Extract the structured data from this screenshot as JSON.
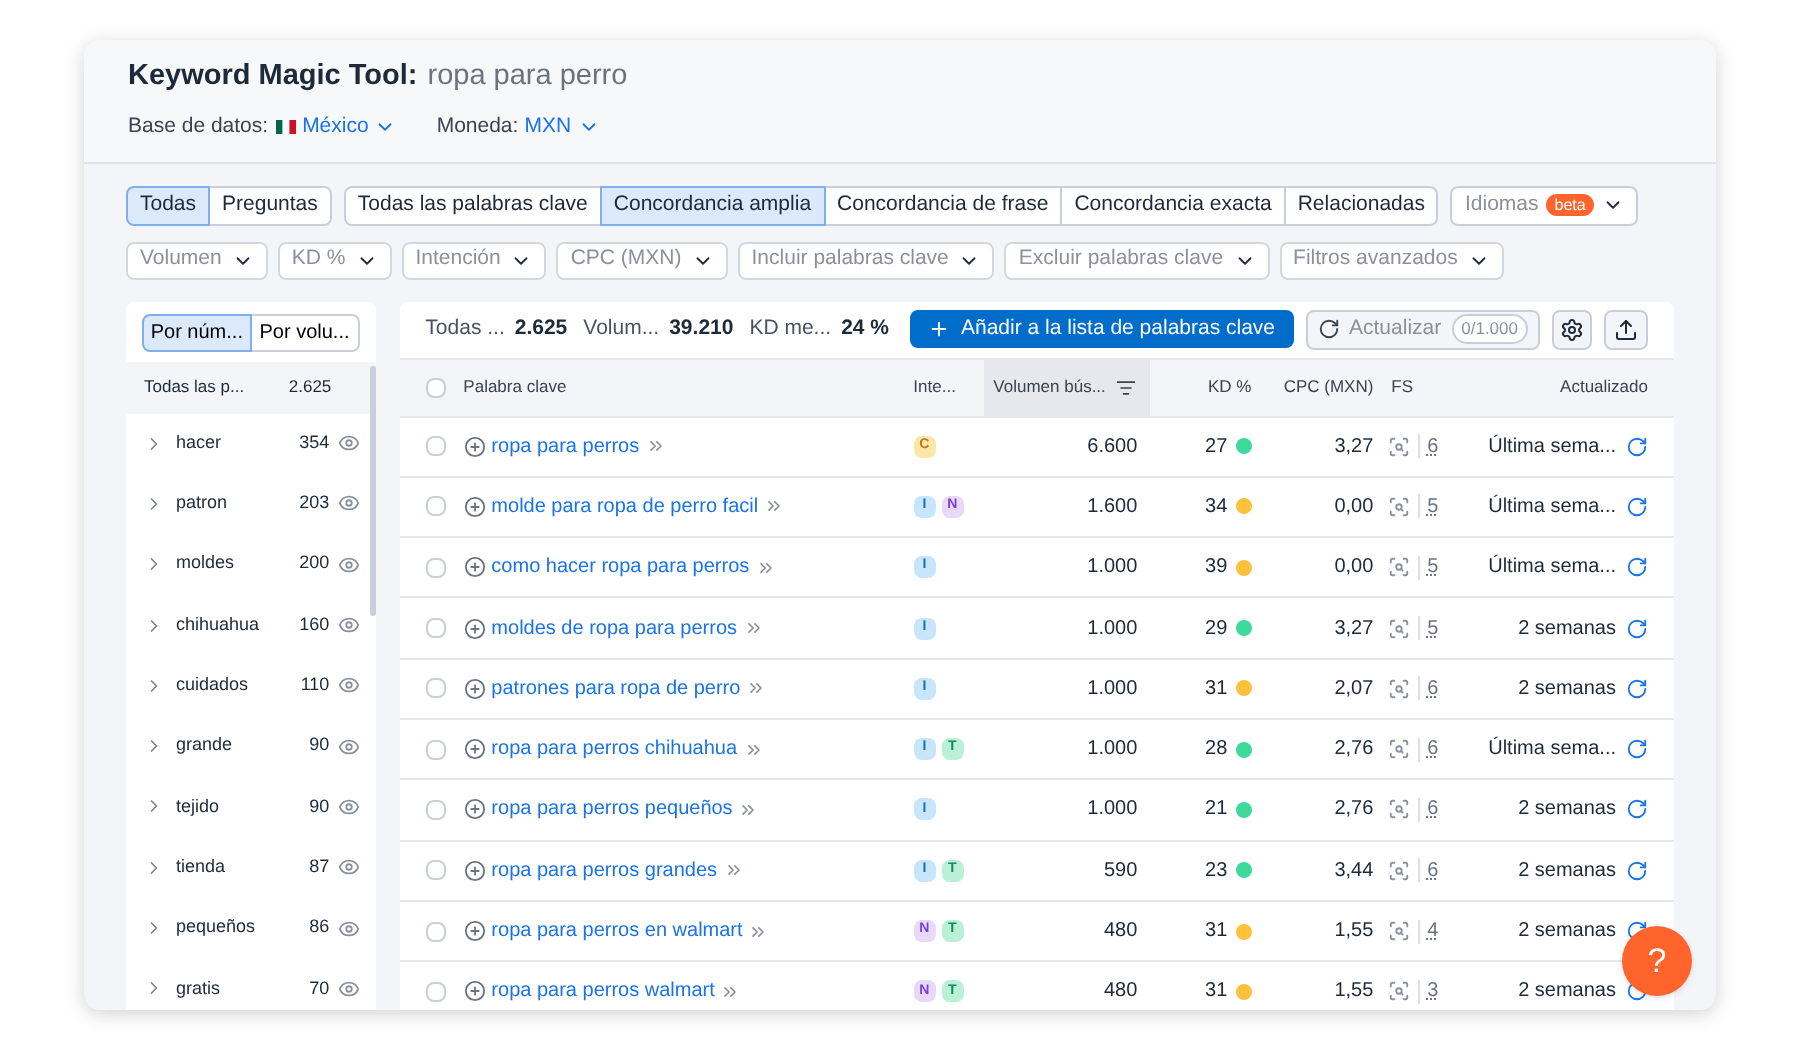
{
  "header": {
    "title": "Keyword Magic Tool:",
    "query": "ropa para perro",
    "database_label": "Base de datos:",
    "database": "México",
    "currency_label": "Moneda:",
    "currency": "MXN"
  },
  "tab_groups": [
    [
      {
        "label": "Todas",
        "selected": true
      },
      {
        "label": "Preguntas",
        "selected": false
      }
    ],
    [
      {
        "label": "Todas las palabras clave",
        "selected": false
      },
      {
        "label": "Concordancia amplia",
        "selected": true
      },
      {
        "label": "Concordancia de frase",
        "selected": false
      },
      {
        "label": "Concordancia exacta",
        "selected": false
      },
      {
        "label": "Relacionadas",
        "selected": false
      }
    ]
  ],
  "languages": {
    "label": "Idiomas",
    "badge": "beta"
  },
  "filters": [
    "Volumen",
    "KD %",
    "Intención",
    "CPC (MXN)",
    "Incluir palabras clave",
    "Excluir palabras clave",
    "Filtros avanzados"
  ],
  "sidebar": {
    "sort": [
      {
        "label": "Por núm...",
        "selected": true
      },
      {
        "label": "Por volu...",
        "selected": false
      }
    ],
    "all": {
      "label": "Todas las p...",
      "count": "2.625"
    },
    "groups": [
      {
        "label": "hacer",
        "count": "354"
      },
      {
        "label": "patron",
        "count": "203"
      },
      {
        "label": "moldes",
        "count": "200"
      },
      {
        "label": "chihuahua",
        "count": "160"
      },
      {
        "label": "cuidados",
        "count": "110"
      },
      {
        "label": "grande",
        "count": "90"
      },
      {
        "label": "tejido",
        "count": "90"
      },
      {
        "label": "tienda",
        "count": "87"
      },
      {
        "label": "pequeños",
        "count": "86"
      },
      {
        "label": "gratis",
        "count": "70"
      }
    ]
  },
  "summary": [
    {
      "label": "Todas ...",
      "value": "2.625"
    },
    {
      "label": "Volum...",
      "value": "39.210"
    },
    {
      "label": "KD me...",
      "value": "24 %"
    }
  ],
  "actions": {
    "add": "Añadir a la lista de palabras clave",
    "refresh": "Actualizar",
    "refresh_count": "0/1.000"
  },
  "table": {
    "select_all_checked": false,
    "columns": [
      "Palabra clave",
      "Inte...",
      "Volumen bús...",
      "KD %",
      "CPC (MXN)",
      "FS",
      "Actualizado"
    ],
    "rows": [
      {
        "keyword": "ropa para perros",
        "intents": [
          {
            "label": "C",
            "kind": "commercial"
          }
        ],
        "volume": "6.600",
        "kd": "27",
        "color": "#3fd99b",
        "checked": false,
        "cpc": "3,27",
        "fs": "6",
        "updated": "Última sema..."
      },
      {
        "keyword": "molde para ropa de perro facil",
        "intents": [
          {
            "label": "I",
            "kind": "informational"
          },
          {
            "label": "N",
            "kind": "navigational"
          }
        ],
        "volume": "1.600",
        "kd": "34",
        "color": "#fdc23c",
        "checked": false,
        "cpc": "0,00",
        "fs": "5",
        "updated": "Última sema..."
      },
      {
        "keyword": "como hacer ropa para perros",
        "intents": [
          {
            "label": "I",
            "kind": "informational"
          }
        ],
        "volume": "1.000",
        "kd": "39",
        "color": "#fdc23c",
        "checked": false,
        "cpc": "0,00",
        "fs": "5",
        "updated": "Última sema..."
      },
      {
        "keyword": "moldes de ropa para perros",
        "intents": [
          {
            "label": "I",
            "kind": "informational"
          }
        ],
        "volume": "1.000",
        "kd": "29",
        "color": "#3fd99b",
        "checked": false,
        "cpc": "3,27",
        "fs": "5",
        "updated": "2 semanas"
      },
      {
        "keyword": "patrones para ropa de perro",
        "intents": [
          {
            "label": "I",
            "kind": "informational"
          }
        ],
        "volume": "1.000",
        "kd": "31",
        "color": "#fdc23c",
        "checked": false,
        "cpc": "2,07",
        "fs": "6",
        "updated": "2 semanas"
      },
      {
        "keyword": "ropa para perros chihuahua",
        "intents": [
          {
            "label": "I",
            "kind": "informational"
          },
          {
            "label": "T",
            "kind": "transactional"
          }
        ],
        "volume": "1.000",
        "kd": "28",
        "color": "#3fd99b",
        "checked": false,
        "cpc": "2,76",
        "fs": "6",
        "updated": "Última sema..."
      },
      {
        "keyword": "ropa para perros pequeños",
        "intents": [
          {
            "label": "I",
            "kind": "informational"
          }
        ],
        "volume": "1.000",
        "kd": "21",
        "color": "#3fd99b",
        "checked": false,
        "cpc": "2,76",
        "fs": "6",
        "updated": "2 semanas"
      },
      {
        "keyword": "ropa para perros grandes",
        "intents": [
          {
            "label": "I",
            "kind": "informational"
          },
          {
            "label": "T",
            "kind": "transactional"
          }
        ],
        "volume": "590",
        "kd": "23",
        "color": "#3fd99b",
        "checked": false,
        "cpc": "3,44",
        "fs": "6",
        "updated": "2 semanas"
      },
      {
        "keyword": "ropa para perros en walmart",
        "intents": [
          {
            "label": "N",
            "kind": "navigational"
          },
          {
            "label": "T",
            "kind": "transactional"
          }
        ],
        "volume": "480",
        "kd": "31",
        "color": "#fdc23c",
        "checked": false,
        "cpc": "1,55",
        "fs": "4",
        "updated": "2 semanas"
      },
      {
        "keyword": "ropa para perros walmart",
        "intents": [
          {
            "label": "N",
            "kind": "navigational"
          },
          {
            "label": "T",
            "kind": "transactional"
          }
        ],
        "volume": "480",
        "kd": "31",
        "color": "#fdc23c",
        "checked": false,
        "cpc": "1,55",
        "fs": "3",
        "updated": "2 semanas"
      }
    ]
  },
  "help": "?"
}
